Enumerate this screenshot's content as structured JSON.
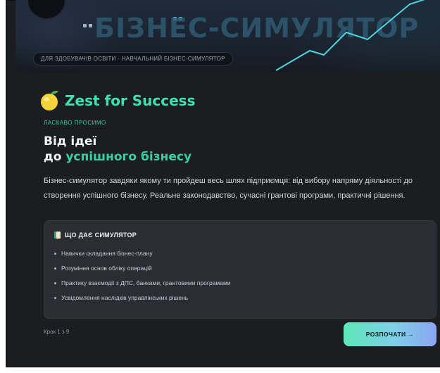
{
  "hero": {
    "bg_title": "БІЗНЕС-СИМУЛЯТОР",
    "tag": "ДЛЯ ЗДОБУВАЧІВ ОСВІТИ · НАВЧАЛЬНИЙ БІЗНЕС-СИМУЛЯТОР"
  },
  "brand": {
    "name": "Zest for Success",
    "icon": "lemon-icon"
  },
  "welcome": "ЛАСКАВО ПРОСИМО",
  "headline": {
    "line1": "Від ідеї",
    "line2_prefix": "до ",
    "line2_accent": "успішного бізнесу"
  },
  "description": "Бізнес-симулятор завдяки якому ти пройдеш весь шлях підприємця: від вибору напряму діяльності до створення успішного бізнесу. Реальне законодавство, сучасні грантові програми, практичні рішення.",
  "benefits": {
    "icon": "book-icon",
    "title": "ЩО ДАЄ СИМУЛЯТОР",
    "items": [
      "Навички складання бізнес-плану",
      "Розуміння основ обліку операцій",
      "Практику взаємодії з ДПС, банками, грантовими програмами",
      "Усвідомлення наслідків управлінських рішень"
    ]
  },
  "footer": {
    "step": "Крок 1 з 9",
    "cta": "РОЗПОЧАТИ →"
  },
  "colors": {
    "accent": "#37d1a0",
    "panel": "#1b1d21",
    "card": "#2a2d33"
  }
}
